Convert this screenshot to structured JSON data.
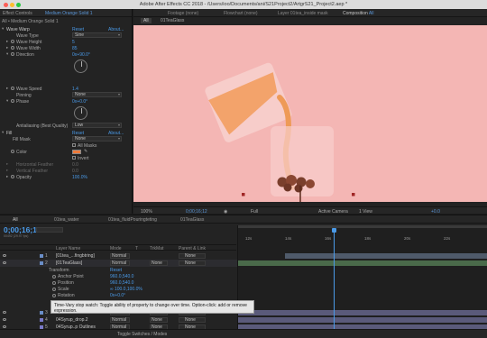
{
  "window": {
    "title": "Adobe After Effects CC 2018 - /Users/ioo/Documents/ani/S21Project2/ArtgrS21_Project2.aep *"
  },
  "effect_controls": {
    "tab_label": "Effect Controls",
    "layer_name": "Medium Orange Solid 1",
    "subtitle": "All • Medium Orange Solid 1",
    "wave_warp": {
      "name": "Wave Warp",
      "reset": "Reset",
      "about": "About...",
      "wave_type_label": "Wave Type",
      "wave_type_value": "Sine",
      "wave_height_label": "Wave Height",
      "wave_height_value": "5",
      "wave_width_label": "Wave Width",
      "wave_width_value": "85",
      "direction_label": "Direction",
      "direction_value": "0x+90.0°",
      "wave_speed_label": "Wave Speed",
      "wave_speed_value": "1.4",
      "pinning_label": "Pinning",
      "pinning_value": "None",
      "phase_label": "Phase",
      "phase_value": "0x+0.0°",
      "antialiasing_label": "Antialiasing (Best Quality)",
      "antialiasing_value": "Low"
    },
    "fill": {
      "name": "Fill",
      "reset": "Reset",
      "about": "About...",
      "fill_mask_label": "Fill Mask",
      "fill_mask_value": "None",
      "all_masks_label": "All Masks",
      "color_label": "Color",
      "invert_label": "Invert",
      "horizontal_feather_label": "Horizontal Feather",
      "horizontal_feather_value": "0.0",
      "vertical_feather_label": "Vertical Feather",
      "vertical_feather_value": "0.0",
      "opacity_label": "Opacity",
      "opacity_value": "100.0%",
      "color_swatch": "#ee7a3a"
    }
  },
  "composition": {
    "tabs": [
      {
        "label": "Footage (none)"
      },
      {
        "label": "Flowchart (none)"
      },
      {
        "label": "Layer 01tea_inside mask"
      },
      {
        "label": "Composition",
        "extra": "All"
      }
    ],
    "subbar": {
      "all_tag": "All",
      "comp_name": "01TeaGlass"
    },
    "viewer_bar": {
      "zoom": "100%",
      "timecode": "0;00;16;12",
      "resolution": "Full",
      "camera": "Active Camera",
      "views": "1 View",
      "exposure": "+0.0"
    },
    "canvas_bg": "#f4b6b4"
  },
  "timeline": {
    "tabs": [
      {
        "label": "All"
      },
      {
        "label": "01tea_water"
      },
      {
        "label": "01tea_fluidPouringteting"
      },
      {
        "label": "01TeaGlass"
      }
    ],
    "timecode": "0;00;16;12",
    "frames_info": "00492 (29.97 fps)",
    "columns": {
      "layer_name": "Layer Name",
      "mode": "Mode",
      "t": "T",
      "trkmat": "TrkMat",
      "parent": "Parent & Link"
    },
    "ruler": [
      "12s",
      "14s",
      "16s",
      "18s",
      "20s",
      "22s"
    ],
    "layers": [
      {
        "index": "1",
        "name": "[01tea_...fingbtring]",
        "mode": "Normal",
        "trkmat": "",
        "parent": "None",
        "color": "#6a8ec8"
      },
      {
        "index": "2",
        "name": "[01TeaGlass]",
        "mode": "Normal",
        "trkmat": "None",
        "parent": "None",
        "color": "#6a8ec8"
      },
      {
        "index": "3",
        "name": "",
        "mode": "Normal",
        "trkmat": "None",
        "parent": "None",
        "color": "#6a8ec8"
      },
      {
        "index": "4",
        "name": "04Syrup_drop.2",
        "mode": "Normal",
        "trkmat": "None",
        "parent": "None",
        "color": "#7a7ac8"
      },
      {
        "index": "5",
        "name": "04Syrup..p Outlines",
        "mode": "Normal",
        "trkmat": "None",
        "parent": "None",
        "color": "#7a7ac8"
      }
    ],
    "transform": {
      "label": "Transform",
      "reset": "Reset",
      "anchor_label": "Anchor Point",
      "anchor_value": "960.0,540.0",
      "position_label": "Position",
      "position_value": "960.0,540.0",
      "scale_label": "Scale",
      "scale_value": "∞ 100.0,100.0%",
      "rotation_label": "Rotation",
      "rotation_value": "0x+0.0°"
    },
    "tooltip": "Time-Vary stop watch: Toggle ability of property to change over time. Option-click: add or remove expression.",
    "toggle_label": "Toggle Switches / Modes"
  }
}
